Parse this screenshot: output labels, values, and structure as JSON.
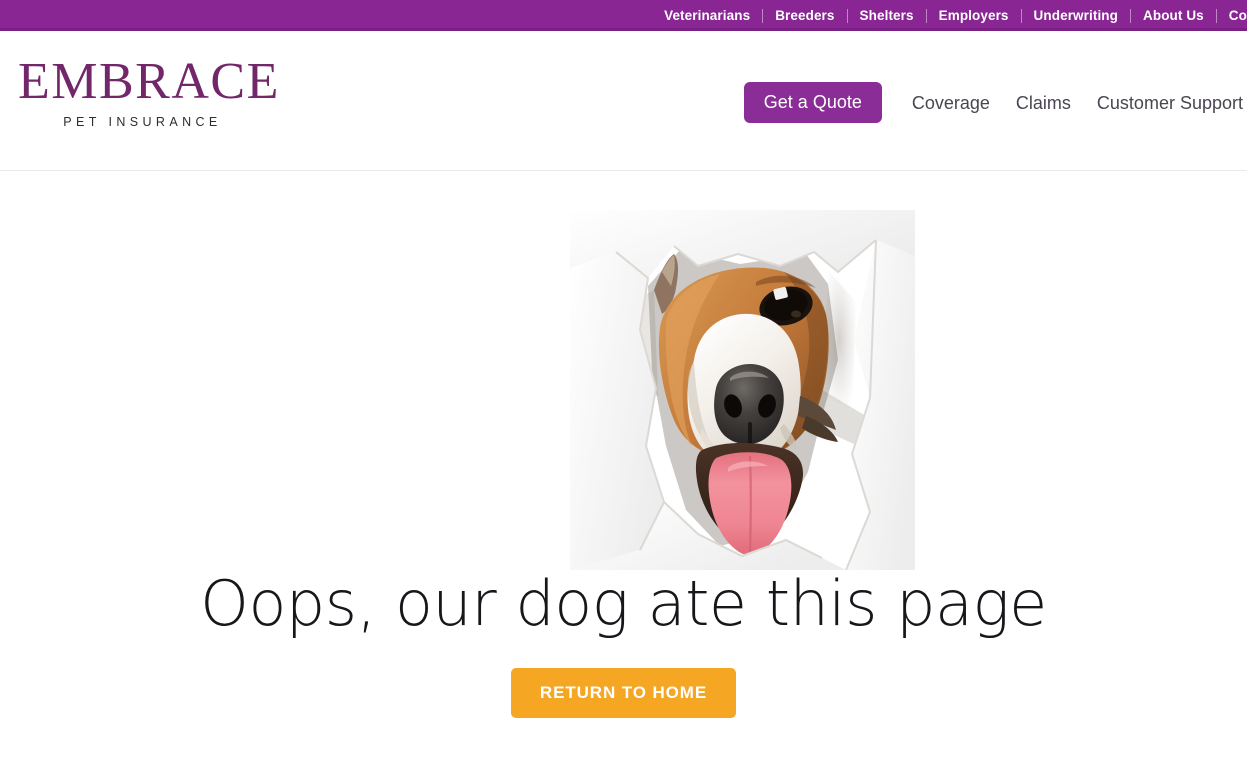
{
  "site": {
    "brand_purple": "#8a2694",
    "accent_orange": "#f5a623",
    "logo_purple": "#73276b"
  },
  "utility_bar": {
    "items": [
      {
        "label": "Veterinarians"
      },
      {
        "label": "Breeders"
      },
      {
        "label": "Shelters"
      },
      {
        "label": "Employers"
      },
      {
        "label": "Underwriting"
      },
      {
        "label": "About Us"
      },
      {
        "label": "Co"
      }
    ]
  },
  "logo": {
    "wordmark": "EMBRACE",
    "tagline": "PET INSURANCE"
  },
  "main_nav": {
    "quote_button": "Get a Quote",
    "links": [
      {
        "label": "Coverage"
      },
      {
        "label": "Claims"
      },
      {
        "label": "Customer Support"
      }
    ]
  },
  "main": {
    "image_alt": "dog-bursting-through-paper",
    "headline": "Oops, our dog ate this page",
    "cta_label": "RETURN TO HOME"
  }
}
